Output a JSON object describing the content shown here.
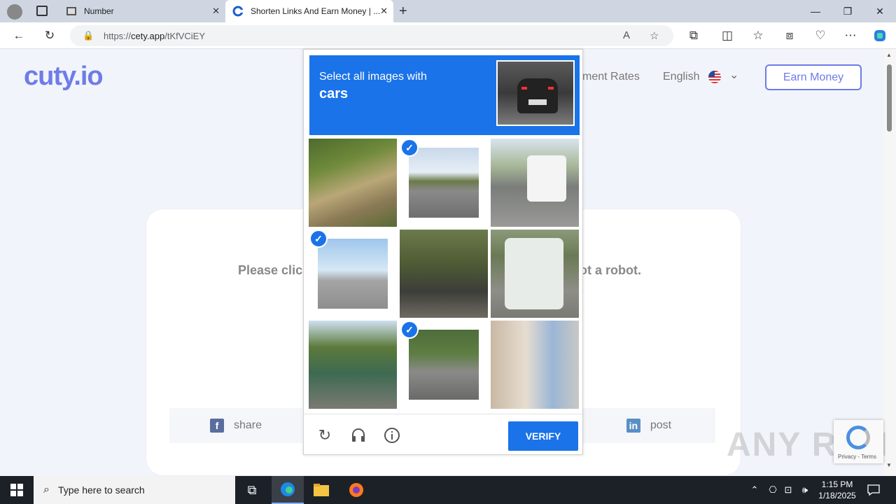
{
  "browser": {
    "tabs": [
      {
        "title": "Number",
        "active": false
      },
      {
        "title": "Shorten Links And Earn Money | ...",
        "active": true
      }
    ],
    "url": {
      "prefix": "https://",
      "domain": "cety.app",
      "path": "/tKfVCiEY"
    },
    "window_controls": {
      "minimize": "—",
      "restore": "❐",
      "close": "✕"
    }
  },
  "site": {
    "logo": "cuty.io",
    "nav_rates": "ment Rates",
    "language": "English",
    "earn_button": "Earn Money",
    "card_text_left": "Please clic",
    "card_text_right": "ot a robot.",
    "share_facebook": "share",
    "share_linkedin": "post"
  },
  "captcha": {
    "instruction": "Select all images with",
    "target": "cars",
    "tiles": [
      {
        "name": "bridge",
        "selected": false
      },
      {
        "name": "street-cars",
        "selected": true
      },
      {
        "name": "bus-road",
        "selected": false
      },
      {
        "name": "road-car",
        "selected": true
      },
      {
        "name": "trees-bus-stop",
        "selected": false
      },
      {
        "name": "bus-rear",
        "selected": false
      },
      {
        "name": "walkway-stairs",
        "selected": false
      },
      {
        "name": "tree-street-cars",
        "selected": true
      },
      {
        "name": "shop-street",
        "selected": false
      }
    ],
    "verify_label": "VERIFY"
  },
  "watermark": "ANY RUN",
  "recaptcha_badge": "Privacy - Terms",
  "taskbar": {
    "search_placeholder": "Type here to search",
    "time": "1:15 PM",
    "date": "1/18/2025"
  },
  "colors": {
    "accent": "#1a73e8",
    "brand": "#6e7ce8"
  }
}
